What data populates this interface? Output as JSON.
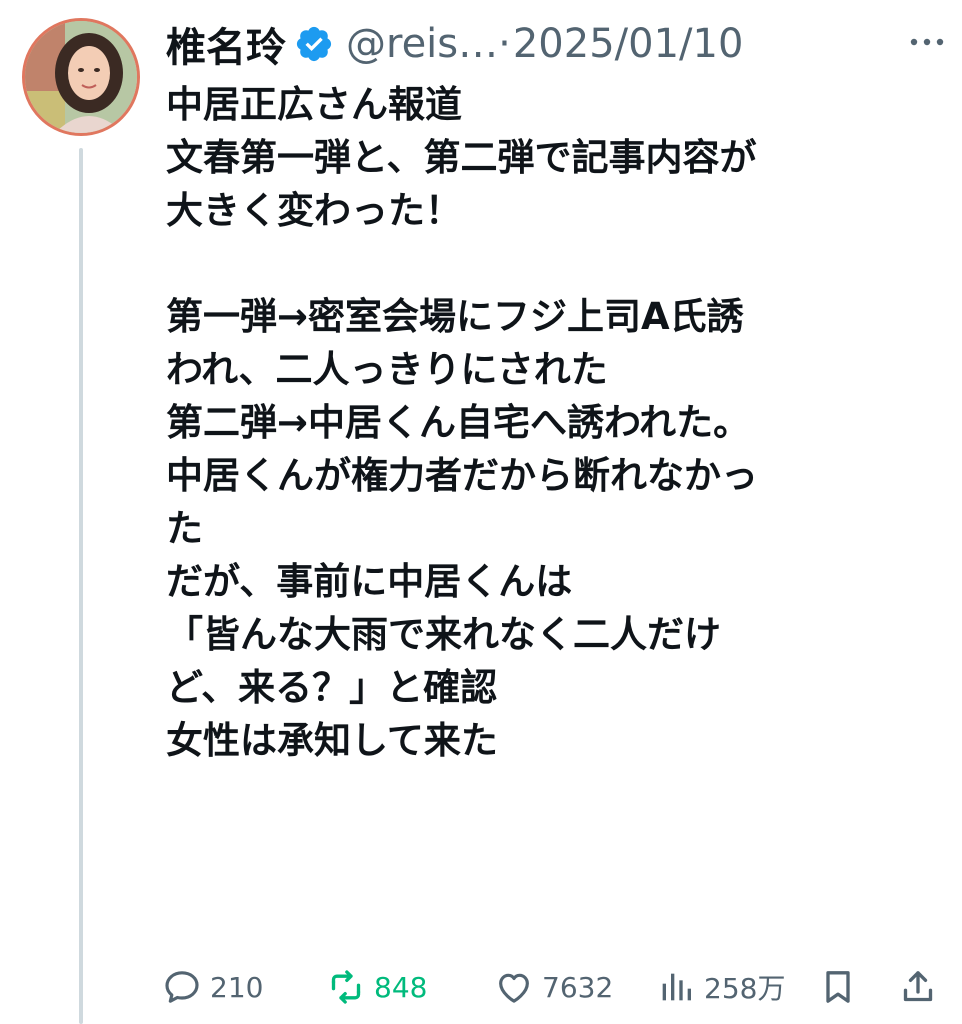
{
  "tweet": {
    "author": {
      "display_name": "椎名玲",
      "handle": "@reis…",
      "verified": true
    },
    "separator": "·",
    "date": "2025/01/10",
    "lines": [
      "中居正広さん報道",
      "文春第一弾と、第二弾で記事内容が",
      "大きく変わった！",
      "",
      "第一弾→密室会場にフジ上司A氏誘",
      "われ、二人っきりにされた",
      "第二弾→中居くん自宅へ誘われた。",
      "中居くんが権力者だから断れなかっ",
      "た",
      "だが、事前に中居くんは",
      "「皆んな大雨で来れなく二人だけ",
      "ど、来る？」と確認",
      "女性は承知して来た"
    ]
  },
  "actions": {
    "replies": "210",
    "retweets": "848",
    "likes": "7632",
    "views": "258万"
  },
  "icons": {
    "verified": "verified-badge-icon",
    "more": "more-dots-icon",
    "reply": "reply-bubble-icon",
    "retweet": "retweet-icon",
    "like": "heart-icon",
    "views": "views-bars-icon",
    "bookmark": "bookmark-icon",
    "share": "share-icon"
  },
  "colors": {
    "verified_blue": "#1d9bf0",
    "retweet_green": "#00ba7c",
    "muted_gray": "#536471",
    "text": "#0f1419",
    "avatar_ring": "#e0775f"
  }
}
